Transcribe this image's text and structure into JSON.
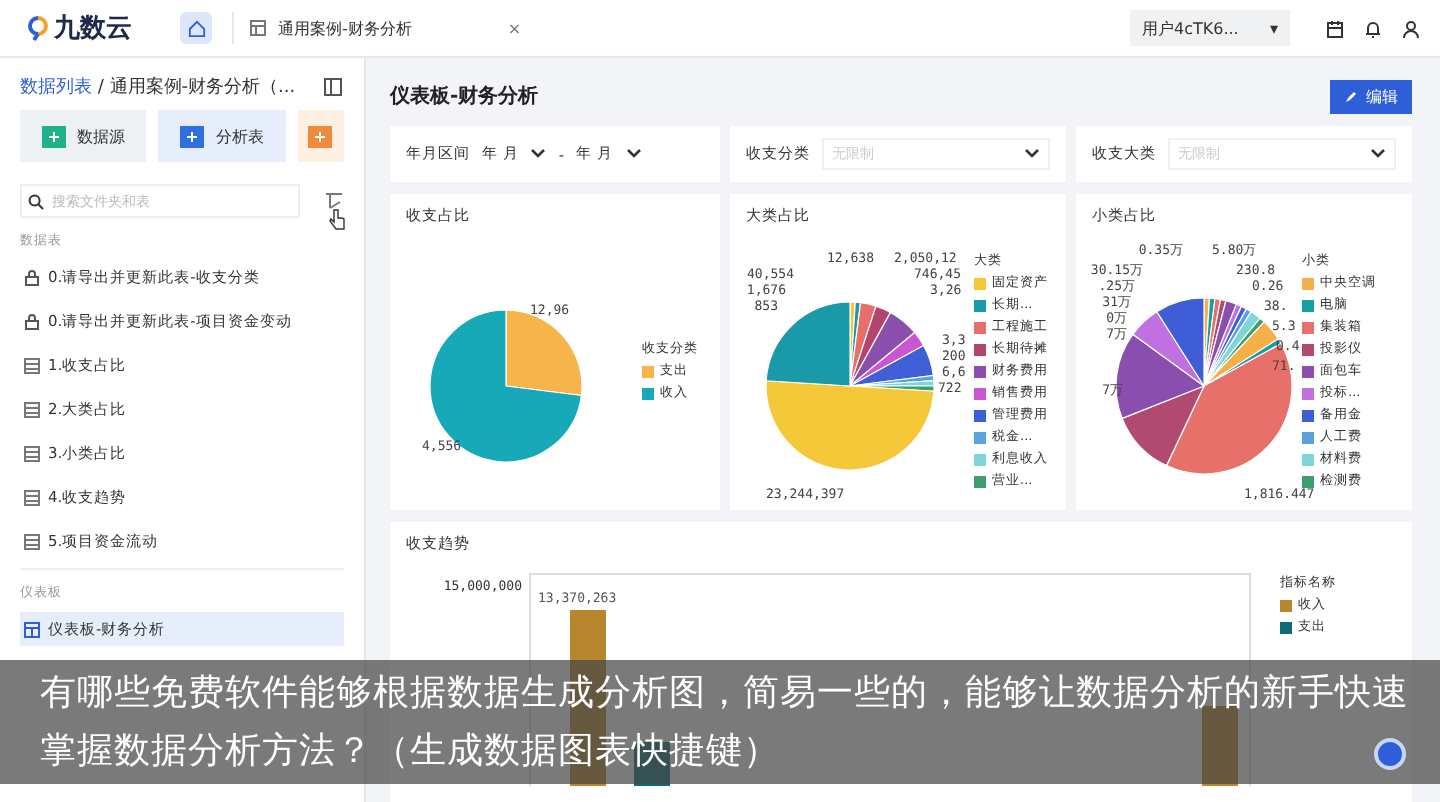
{
  "topbar": {
    "logo": "九数云",
    "tabs": [
      {
        "kind": "home",
        "selected": true
      },
      {
        "kind": "doc",
        "label": "通用案例-财务分析",
        "close": "×",
        "selected": false
      }
    ],
    "user": "用户4cTK6...",
    "user_caret": "▾"
  },
  "sidebar": {
    "breadcrumb": "数据列表 / 通用案例-财务分析（...",
    "create_buttons": [
      {
        "kind": "source",
        "label": "数据源"
      },
      {
        "kind": "table",
        "label": "分析表"
      },
      {
        "kind": "dashboard"
      }
    ],
    "search": {
      "placeholder": "搜索文件夹和表"
    },
    "sections": [
      {
        "title": "数据表",
        "items": [
          {
            "kind": "locked",
            "label": "0.请导出并更新此表-收支分类",
            "selected": false
          },
          {
            "kind": "locked",
            "label": "0.请导出并更新此表-项目资金变动",
            "selected": false
          },
          {
            "kind": "table",
            "label": "1.收支占比",
            "selected": false
          },
          {
            "kind": "table",
            "label": "2.大类占比",
            "selected": false
          },
          {
            "kind": "table",
            "label": "3.小类占比",
            "selected": false
          },
          {
            "kind": "table",
            "label": "4.收支趋势",
            "selected": false
          },
          {
            "kind": "table",
            "label": "5.项目资金流动",
            "selected": false
          }
        ]
      },
      {
        "title": "仪表板",
        "items": [
          {
            "kind": "dashboard",
            "label": "仪表板-财务分析",
            "selected": true
          }
        ]
      }
    ]
  },
  "main": {
    "title": "仪表板-财务分析",
    "edit_button": "编辑",
    "filters": [
      {
        "kind": "range",
        "label": "年月区间",
        "from": [
          "年",
          "月"
        ],
        "separator": "-",
        "to": [
          "年",
          "月"
        ]
      },
      {
        "kind": "select",
        "label": "收支分类",
        "placeholder": "无限制"
      },
      {
        "kind": "select",
        "label": "收支大类",
        "placeholder": "无限制"
      }
    ],
    "pies": [
      {
        "title": "收支占比",
        "legend_title": "收支分类",
        "legend": [
          {
            "label": "支出",
            "color": "#f6b44b"
          },
          {
            "label": "收入",
            "color": "#17a9b8"
          }
        ],
        "labels": [
          "12,96",
          "4,556"
        ]
      },
      {
        "title": "大类占比",
        "legend_title": "大类",
        "legend": [
          {
            "label": "固定资产",
            "color": "#f5c83a"
          },
          {
            "label": "长期...",
            "color": "#1a9aa8"
          },
          {
            "label": "工程施工",
            "color": "#e86e6a"
          },
          {
            "label": "长期待摊",
            "color": "#b3456c"
          },
          {
            "label": "财务费用",
            "color": "#8b4fae"
          },
          {
            "label": "销售费用",
            "color": "#cc55d2"
          },
          {
            "label": "管理费用",
            "color": "#3f5fd6"
          },
          {
            "label": "税金...",
            "color": "#5ba2e0"
          },
          {
            "label": "利息收入",
            "color": "#7fd6d6"
          },
          {
            "label": "营业...",
            "color": "#3b9f6f"
          }
        ],
        "labels": [
          "12,638",
          "40,554",
          "1,676",
          "853",
          "2,050,12",
          "746,45",
          "3,26",
          "3,3",
          "200",
          "6,6",
          "722",
          "23,244,397"
        ]
      },
      {
        "title": "小类占比",
        "legend_title": "小类",
        "legend": [
          {
            "label": "中央空调",
            "color": "#f6b04a"
          },
          {
            "label": "电脑",
            "color": "#179e9e"
          },
          {
            "label": "集装箱",
            "color": "#e8706a"
          },
          {
            "label": "投影仪",
            "color": "#b04a70"
          },
          {
            "label": "面包车",
            "color": "#8a4fae"
          },
          {
            "label": "投标...",
            "color": "#c070e0"
          },
          {
            "label": "备用金",
            "color": "#3f5ed6"
          },
          {
            "label": "人工费",
            "color": "#5aa0e0"
          },
          {
            "label": "材料费",
            "color": "#7fd6d6"
          },
          {
            "label": "检测费",
            "color": "#3aa070"
          }
        ],
        "labels": [
          "0.35万",
          "30.15万",
          ".25万",
          "31万",
          "0万",
          "7万",
          "7万",
          "5.80万",
          "230.8",
          "0.26",
          "38.",
          "5.3",
          "0.4",
          "71.",
          "1,816.447"
        ]
      }
    ],
    "trend": {
      "title": "收支趋势",
      "yticks": [
        "15,000,000"
      ],
      "value_labels": [
        "13,370,263"
      ],
      "legend_title": "指标名称",
      "legend": [
        {
          "label": "收入",
          "color": "#b8862e"
        },
        {
          "label": "支出",
          "color": "#0e6b78"
        }
      ]
    }
  },
  "caption": "有哪些免费软件能够根据数据生成分析图，简易一些的，能够让数据分析的新手快速掌握数据分析方法？（生成数据图表快捷键）"
}
